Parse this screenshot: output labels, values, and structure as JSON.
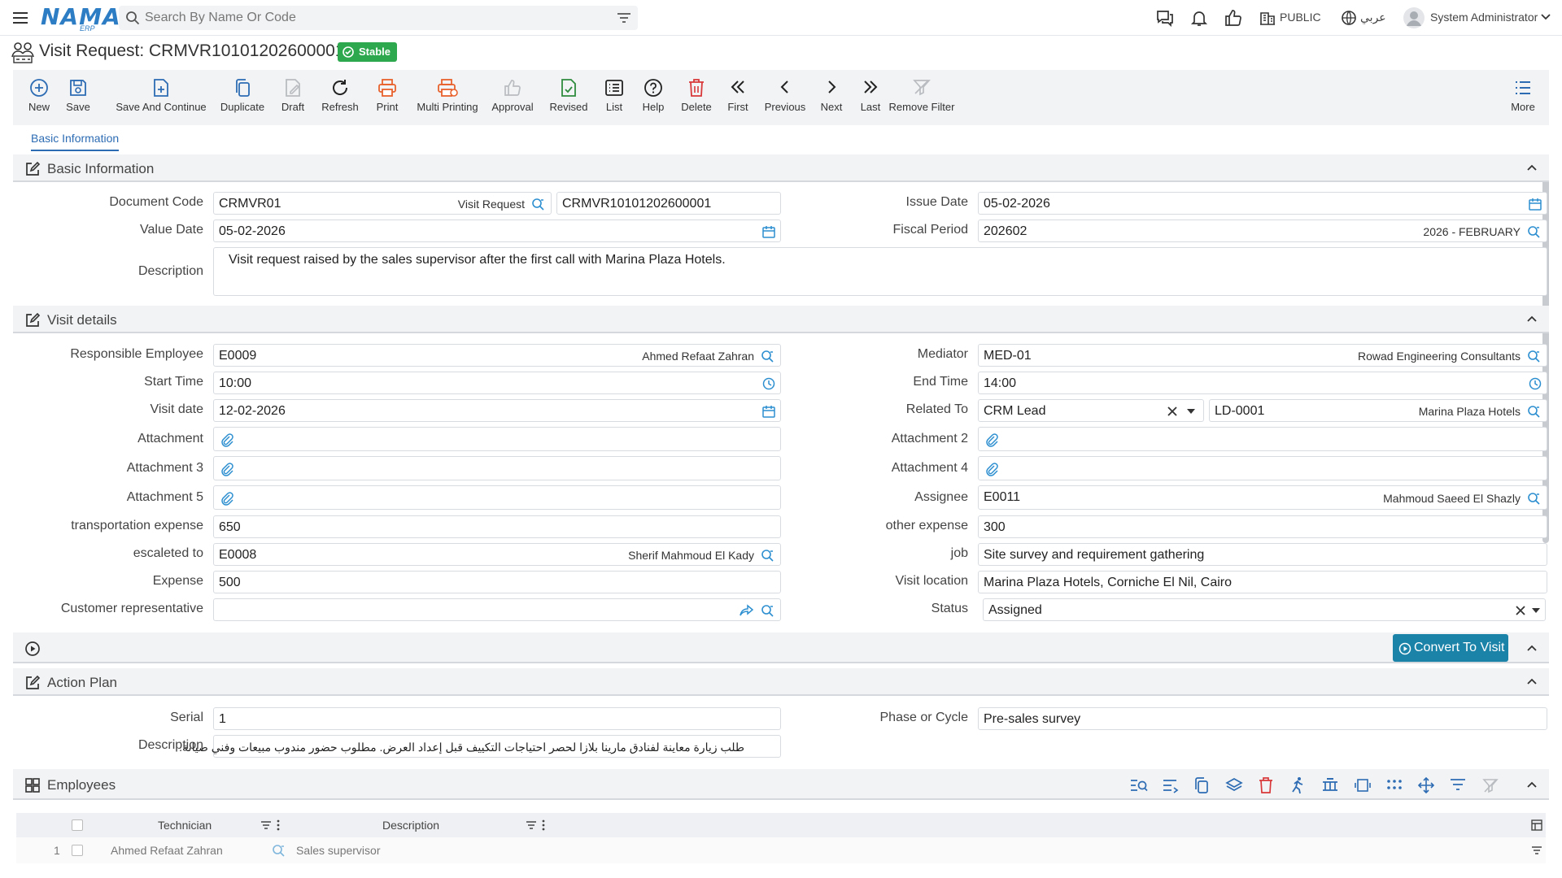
{
  "app": {
    "logo": "NAMA",
    "logo_sub": "ERP",
    "search_placeholder": "Search By Name Or Code",
    "public_label": "PUBLIC",
    "lang_label": "عربي",
    "user_name": "System Administrator"
  },
  "page": {
    "title": "Visit Request: CRMVR10101202600001",
    "status_badge": "Stable"
  },
  "toolbar": {
    "new": "New",
    "save": "Save",
    "save_continue": "Save And Continue",
    "duplicate": "Duplicate",
    "draft": "Draft",
    "refresh": "Refresh",
    "print": "Print",
    "multi_printing": "Multi Printing",
    "approval": "Approval",
    "revised": "Revised",
    "list": "List",
    "help": "Help",
    "delete": "Delete",
    "first": "First",
    "previous": "Previous",
    "next": "Next",
    "last": "Last",
    "remove_filter": "Remove Filter",
    "more": "More"
  },
  "tabs": {
    "basic": "Basic Information"
  },
  "basic": {
    "title": "Basic Information",
    "doc_code_label": "Document Code",
    "doc_code": "CRMVR01",
    "doc_code_name": "Visit Request",
    "doc_number": "CRMVR10101202600001",
    "issue_date_label": "Issue Date",
    "issue_date": "05-02-2026",
    "value_date_label": "Value Date",
    "value_date": "05-02-2026",
    "fiscal_period_label": "Fiscal Period",
    "fiscal_period": "202602",
    "fiscal_period_name": "2026 - FEBRUARY",
    "description_label": "Description",
    "description": "Visit request raised by the sales supervisor after the first call with Marina Plaza Hotels."
  },
  "visit": {
    "title": "Visit details",
    "resp_emp_label": "Responsible Employee",
    "resp_emp": "E0009",
    "resp_emp_name": "Ahmed Refaat Zahran",
    "mediator_label": "Mediator",
    "mediator": "MED-01",
    "mediator_name": "Rowad Engineering Consultants",
    "start_time_label": "Start Time",
    "start_time": "10:00",
    "end_time_label": "End Time",
    "end_time": "14:00",
    "visit_date_label": "Visit date",
    "visit_date": "12-02-2026",
    "related_to_label": "Related To",
    "related_to": "CRM Lead",
    "related_code": "LD-0001",
    "related_name": "Marina Plaza Hotels",
    "attachment_label": "Attachment",
    "attachment2_label": "Attachment 2",
    "attachment3_label": "Attachment 3",
    "attachment4_label": "Attachment 4",
    "attachment5_label": "Attachment 5",
    "assignee_label": "Assignee",
    "assignee": "E0011",
    "assignee_name": "Mahmoud Saeed El Shazly",
    "transport_label": "transportation expense",
    "transport": "650",
    "other_label": "other expense",
    "other": "300",
    "escalated_label": "escaleted to",
    "escalated": "E0008",
    "escalated_name": "Sherif Mahmoud El Kady",
    "job_label": "job",
    "job": "Site survey and requirement gathering",
    "expense_label": "Expense",
    "expense": "500",
    "location_label": "Visit location",
    "location": "Marina Plaza Hotels, Corniche El Nil, Cairo",
    "customer_rep_label": "Customer representative",
    "customer_rep": "",
    "status_label": "Status",
    "status": "Assigned"
  },
  "convert": {
    "label": "Convert To Visit"
  },
  "action_plan": {
    "title": "Action Plan",
    "serial_label": "Serial",
    "serial": "1",
    "phase_label": "Phase or Cycle",
    "phase": "Pre-sales survey",
    "description_label": "Description",
    "description": "طلب زيارة معاينة لفنادق مارينا بلازا لحصر احتياجات التكييف قبل إعداد العرض. مطلوب حضور مندوب مبيعات وفني صيانة."
  },
  "employees": {
    "title": "Employees",
    "col_technician": "Technician",
    "col_description": "Description",
    "rows": [
      {
        "num": "1",
        "technician": "Ahmed Refaat Zahran",
        "description": "Sales supervisor"
      }
    ]
  },
  "colors": {
    "accent": "#2d6cb3",
    "badge": "#2ea84f",
    "convert": "#1b82a8",
    "print": "#e8612c",
    "delete": "#d9383a",
    "revised": "#2e8b3d"
  }
}
